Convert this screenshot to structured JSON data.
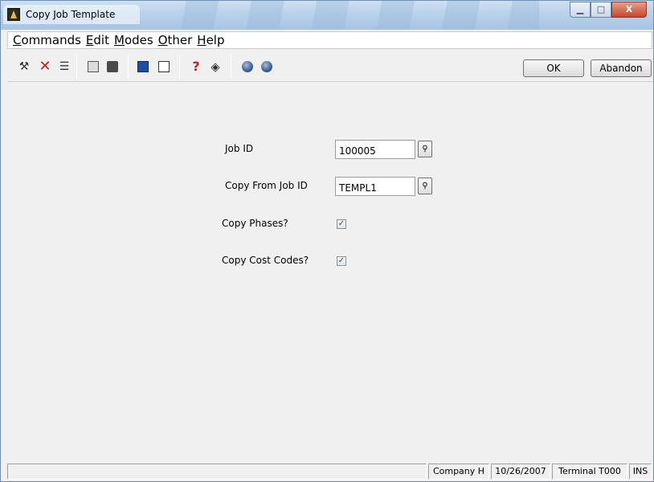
{
  "window": {
    "title": "Copy Job Template"
  },
  "menu": [
    {
      "label": "Commands"
    },
    {
      "label": "Edit"
    },
    {
      "label": "Modes"
    },
    {
      "label": "Other"
    },
    {
      "label": "Help"
    }
  ],
  "toolbar": {
    "icons": [
      "tools-icon",
      "delete-icon",
      "list-icon",
      "copy-icon",
      "paste-icon",
      "calculator-icon",
      "calendar-icon",
      "help-icon",
      "manual-icon",
      "globe-back-icon",
      "globe-forward-icon"
    ],
    "ok_label": "OK",
    "abandon_label": "Abandon"
  },
  "form": {
    "job_id": {
      "label": "Job ID",
      "value": "100005"
    },
    "copy_from_job_id": {
      "label": "Copy From Job ID",
      "value": "TEMPL1"
    },
    "copy_phases": {
      "label": "Copy Phases?",
      "checked": true
    },
    "copy_cost_codes": {
      "label": "Copy Cost Codes?",
      "checked": true
    }
  },
  "status": {
    "company": "Company H",
    "date": "10/26/2007",
    "terminal": "Terminal T000",
    "mode": "INS"
  },
  "colors": {
    "title_bar": "#b9d1ea",
    "close_button": "#c8452a",
    "background": "#f0f0f0"
  }
}
